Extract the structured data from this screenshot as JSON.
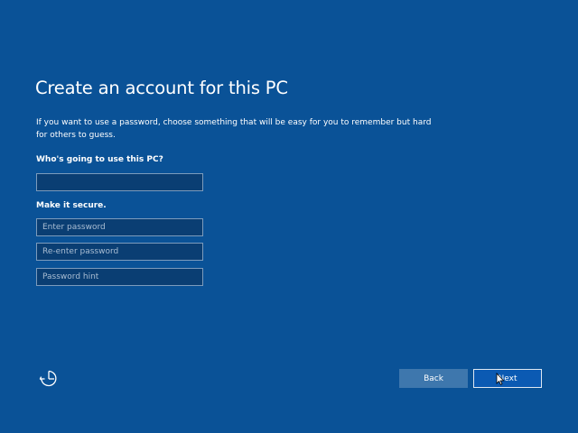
{
  "page": {
    "title": "Create an account for this PC",
    "description": "If you want to use a password, choose something that will be easy for you to remember but hard for others to guess."
  },
  "form": {
    "user_label": "Who's going to use this PC?",
    "user_value": "",
    "secure_label": "Make it secure.",
    "password_placeholder": "Enter password",
    "password_value": "",
    "reenter_placeholder": "Re-enter password",
    "reenter_value": "",
    "hint_placeholder": "Password hint",
    "hint_value": ""
  },
  "footer": {
    "accessibility_icon": "ease-of-access-icon",
    "back_label": "Back",
    "next_label": "Next"
  },
  "colors": {
    "background": "#0a5297",
    "field_background": "#0a3e73",
    "back_button": "#3e77ad",
    "next_button": "#0b5ab3"
  }
}
